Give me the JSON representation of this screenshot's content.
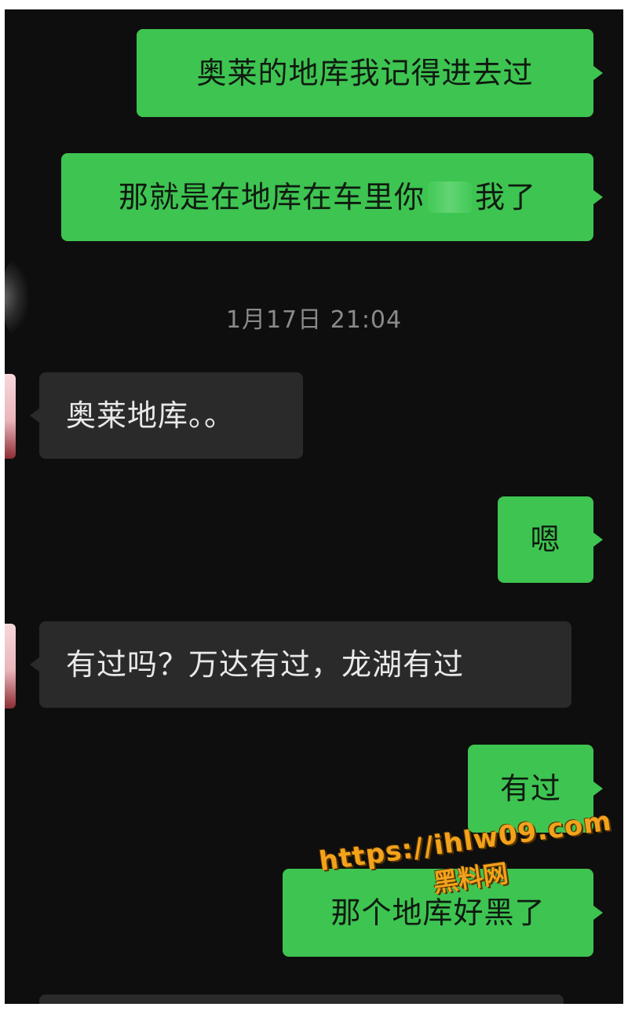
{
  "theme": {
    "background": "#0e0e0e",
    "outgoing_bubble": "#3ec451",
    "incoming_bubble": "#2a2a2a",
    "timestamp_color": "#8a8a8a",
    "watermark_color": "#f2a21c"
  },
  "chat": {
    "messages": [
      {
        "direction": "out",
        "text": "奥莱的地库我记得进去过"
      },
      {
        "direction": "out",
        "text_before": "那就是在地库在车里你",
        "redacted": true,
        "text_after": "我了"
      },
      {
        "type": "timestamp",
        "text": "1月17日 21:04"
      },
      {
        "direction": "in",
        "text": "奥莱地库。。"
      },
      {
        "direction": "out",
        "text": "嗯"
      },
      {
        "direction": "in",
        "text": "有过吗？万达有过，龙湖有过"
      },
      {
        "direction": "out",
        "text": "有过"
      },
      {
        "direction": "out",
        "text": "那个地库好黑了"
      }
    ]
  },
  "watermark": {
    "url": "https://ihlw09.com",
    "label": "黑料网"
  }
}
